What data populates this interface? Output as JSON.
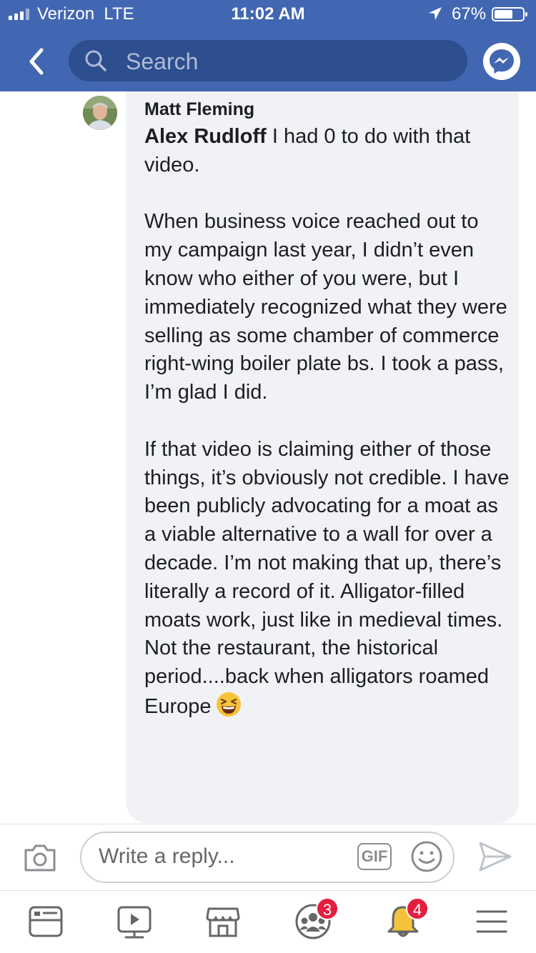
{
  "status_bar": {
    "carrier": "Verizon",
    "network": "LTE",
    "time": "11:02 AM",
    "battery": "67%",
    "battery_level": 0.67
  },
  "header": {
    "search_placeholder": "Search",
    "back_icon": "chevron-left-icon",
    "messenger_icon": "messenger-icon"
  },
  "comment": {
    "author": "Matt Fleming",
    "mention": "Alex Rudloff",
    "first_line_rest": " I had 0 to do with that video.",
    "paragraph2": "When business voice reached out to my campaign last year, I didn’t even know who either of you were, but I immediately recognized what they were selling as some chamber of commerce right-wing boiler plate bs. I took a pass, I’m glad I did.",
    "paragraph3": "If that video is claiming either of those things, it’s obviously not credible. I have been publicly advocating for a moat as a viable alternative to a wall for over a decade. I’m not making that up, there’s literally a record of it. Alligator-filled moats work, just like in medieval times. Not the restaurant, the historical period....back when alligators roamed Europe",
    "emoji": "grinning-squinting-face-emoji"
  },
  "reply_bar": {
    "placeholder": "Write a reply...",
    "gif_label": "GIF"
  },
  "bottom_nav": {
    "items": [
      {
        "icon": "news-feed-icon"
      },
      {
        "icon": "watch-video-icon"
      },
      {
        "icon": "marketplace-icon"
      },
      {
        "icon": "groups-icon",
        "badge": "3"
      },
      {
        "icon": "notifications-bell-icon",
        "badge": "4"
      },
      {
        "icon": "menu-icon"
      }
    ]
  },
  "colors": {
    "brand_blue": "#4267b2",
    "search_bg": "#2d4e8f",
    "bubble_bg": "#f0f2f5",
    "badge_red": "#e41e3f"
  }
}
